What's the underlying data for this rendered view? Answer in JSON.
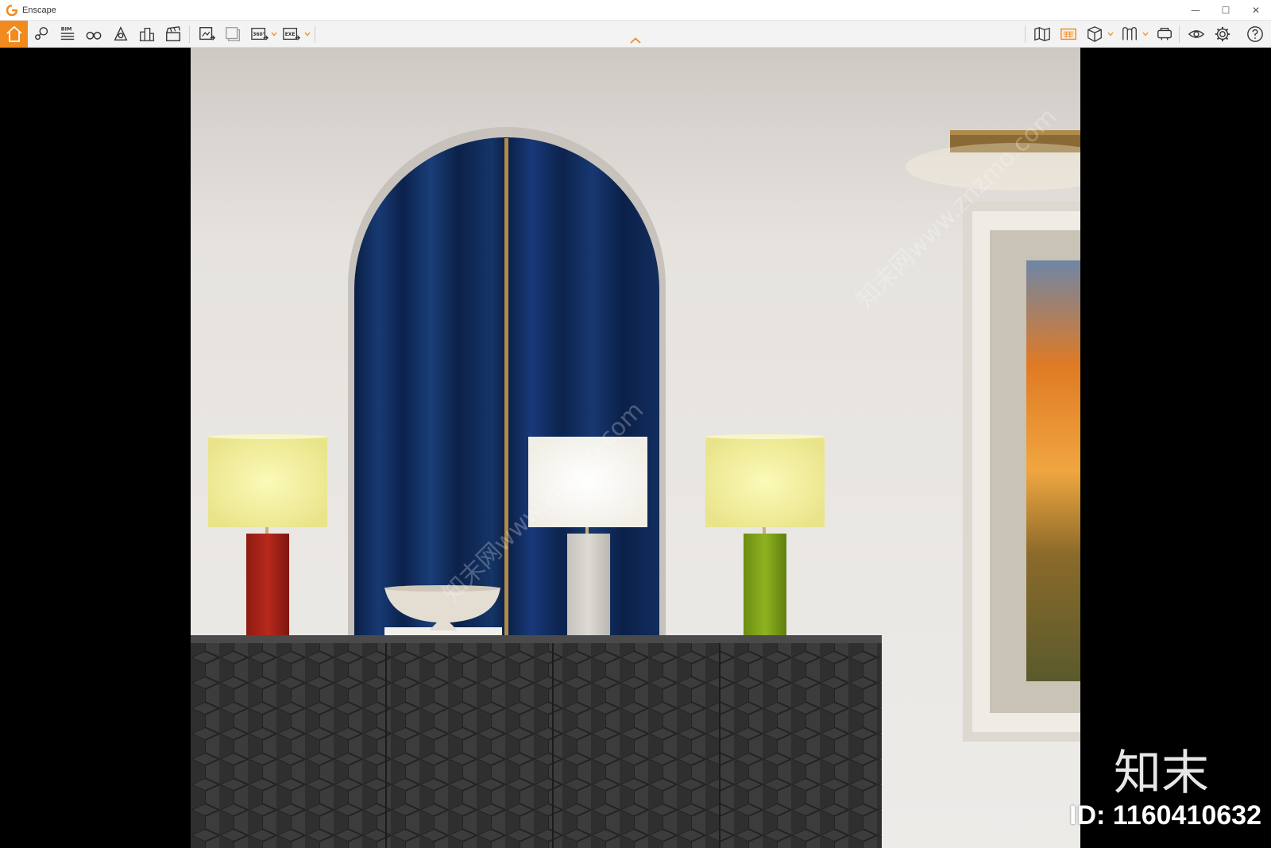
{
  "window": {
    "title": "Enscape",
    "accent": "#f28a1e",
    "controls": {
      "minimize": "—",
      "maximize": "☐",
      "close": "✕"
    }
  },
  "toolbar": {
    "bim_label": "BIM",
    "render_360_label": "360°",
    "exe_label": "EXE",
    "left_icons": [
      "home-icon",
      "location-pin-icon",
      "bim-list-icon",
      "binoculars-icon",
      "navigation-icon",
      "buildings-icon",
      "clapperboard-icon",
      "screenshot-icon",
      "batch-render-icon",
      "render-360-icon",
      "export-exe-icon"
    ],
    "right_icons": [
      "map-icon",
      "asset-library-icon",
      "view-cube-icon",
      "material-editor-icon",
      "vr-headset-icon",
      "visibility-icon",
      "settings-icon",
      "help-icon"
    ]
  },
  "overlay": {
    "brand_text": "知末",
    "id_text": "ID: 1160410632",
    "watermark": "知末网www.znzmo.com"
  },
  "scene": {
    "wall_color": "#e9e6e3",
    "curtain_color": "#0f2a57",
    "lamp_shade_color": "#f3f2a6",
    "cabinet_color": "#3a3a3a"
  }
}
